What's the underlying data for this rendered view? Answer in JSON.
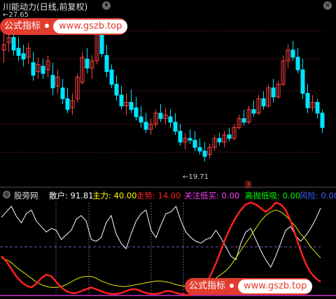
{
  "title": "川能动力(日线,前复权)",
  "upper": {
    "high_label": "27.65",
    "low_label": "19.71",
    "signal": "涨"
  },
  "badges": {
    "label": "公式指标",
    "site": "www.gszb.top"
  },
  "indicator": {
    "name": "股旁网",
    "items": [
      {
        "label": "散户",
        "value": "91.81",
        "color": "#ffffff"
      },
      {
        "label": "主力",
        "value": "40.00",
        "color": "#ffff00"
      },
      {
        "label": "走势",
        "value": "14.00",
        "color": "#ff2020"
      },
      {
        "label": "关注低买",
        "value": "0.00",
        "color": "#ff40ff"
      },
      {
        "label": "高抛低吸",
        "value": "0.00",
        "color": "#00ff00"
      },
      {
        "label": "风险",
        "value": "0.00",
        "color": "#4060ff"
      }
    ]
  },
  "colors": {
    "up": "#ff4040",
    "down": "#00e5ff",
    "grid": "#b03030",
    "ind_grid": "#7a4fb0"
  },
  "candles": [
    [
      25.9,
      26.8,
      25.2,
      26.2
    ],
    [
      26.3,
      27.2,
      25.8,
      26.6
    ],
    [
      26.6,
      27.65,
      25.6,
      25.9
    ],
    [
      26.0,
      26.6,
      25.3,
      25.6
    ],
    [
      25.7,
      26.2,
      25.0,
      25.4
    ],
    [
      25.5,
      26.3,
      25.1,
      26.0
    ],
    [
      25.2,
      25.8,
      24.2,
      24.5
    ],
    [
      24.7,
      25.5,
      24.3,
      25.1
    ],
    [
      25.0,
      25.4,
      24.3,
      24.6
    ],
    [
      24.8,
      25.6,
      24.4,
      25.3
    ],
    [
      24.5,
      25.2,
      23.4,
      23.8
    ],
    [
      23.9,
      24.8,
      23.5,
      24.4
    ],
    [
      23.8,
      24.3,
      22.9,
      23.2
    ],
    [
      23.2,
      23.8,
      22.4,
      22.6
    ],
    [
      22.7,
      23.5,
      22.3,
      23.1
    ],
    [
      23.2,
      24.6,
      23.0,
      24.4
    ],
    [
      24.1,
      25.8,
      24.0,
      25.5
    ],
    [
      25.4,
      26.0,
      24.6,
      24.9
    ],
    [
      24.9,
      25.6,
      24.3,
      25.3
    ],
    [
      25.3,
      27.1,
      25.1,
      26.9
    ],
    [
      26.8,
      27.4,
      25.5,
      25.7
    ],
    [
      25.6,
      26.2,
      24.4,
      24.7
    ],
    [
      24.8,
      25.1,
      23.8,
      24.0
    ],
    [
      24.0,
      24.5,
      23.1,
      23.4
    ],
    [
      23.4,
      23.9,
      22.6,
      22.8
    ],
    [
      22.8,
      23.5,
      22.3,
      23.0
    ],
    [
      23.0,
      23.7,
      22.4,
      22.6
    ],
    [
      22.7,
      23.3,
      22.0,
      22.2
    ],
    [
      22.2,
      22.8,
      21.6,
      21.9
    ],
    [
      21.9,
      22.4,
      21.3,
      21.5
    ],
    [
      21.5,
      22.1,
      21.2,
      21.8
    ],
    [
      21.8,
      22.6,
      21.6,
      22.4
    ],
    [
      22.4,
      22.9,
      21.9,
      22.1
    ],
    [
      22.1,
      22.7,
      21.8,
      22.3
    ],
    [
      22.2,
      22.6,
      21.6,
      21.9
    ],
    [
      21.9,
      22.4,
      21.2,
      21.4
    ],
    [
      21.4,
      21.8,
      20.6,
      20.8
    ],
    [
      20.8,
      21.3,
      20.4,
      21.0
    ],
    [
      21.0,
      21.5,
      20.7,
      20.9
    ],
    [
      20.9,
      21.4,
      20.3,
      20.5
    ],
    [
      20.5,
      21.0,
      20.1,
      20.3
    ],
    [
      20.3,
      20.8,
      19.71,
      20.0
    ],
    [
      20.1,
      20.7,
      19.9,
      20.5
    ],
    [
      20.5,
      21.2,
      20.3,
      21.0
    ],
    [
      21.0,
      21.3,
      20.6,
      20.8
    ],
    [
      20.8,
      21.4,
      20.5,
      21.2
    ],
    [
      21.2,
      21.6,
      20.8,
      21.0
    ],
    [
      21.0,
      21.8,
      20.9,
      21.6
    ],
    [
      21.6,
      22.3,
      21.5,
      22.1
    ],
    [
      22.1,
      22.6,
      21.7,
      21.9
    ],
    [
      21.9,
      22.8,
      21.8,
      22.6
    ],
    [
      22.6,
      23.1,
      22.2,
      22.4
    ],
    [
      22.4,
      23.4,
      22.3,
      23.2
    ],
    [
      23.2,
      23.6,
      22.6,
      22.8
    ],
    [
      22.8,
      24.0,
      22.7,
      23.8
    ],
    [
      23.8,
      24.3,
      23.0,
      23.3
    ],
    [
      23.3,
      24.2,
      23.2,
      24.0
    ],
    [
      24.0,
      25.6,
      23.9,
      25.3
    ],
    [
      25.3,
      26.2,
      24.9,
      25.9
    ],
    [
      25.9,
      26.4,
      25.3,
      25.5
    ],
    [
      25.5,
      26.0,
      24.6,
      24.8
    ],
    [
      24.8,
      25.4,
      23.2,
      23.5
    ],
    [
      23.5,
      24.0,
      22.4,
      22.7
    ],
    [
      22.7,
      23.4,
      22.5,
      23.0
    ],
    [
      23.0,
      23.2,
      22.1,
      22.4
    ],
    [
      22.4,
      22.6,
      21.3,
      21.6
    ]
  ],
  "series": {
    "retail": [
      84,
      90,
      96,
      85,
      78,
      88,
      92,
      80,
      74,
      68,
      72,
      70,
      60,
      65,
      70,
      82,
      86,
      80,
      60,
      58,
      62,
      78,
      86,
      66,
      56,
      50,
      66,
      80,
      88,
      92,
      70,
      62,
      76,
      88,
      90,
      96,
      80,
      68,
      62,
      58,
      56,
      60,
      62,
      70,
      62,
      52,
      42,
      38,
      56,
      68,
      72,
      60,
      48,
      38,
      30,
      42,
      56,
      70,
      74,
      64,
      58,
      64,
      72,
      82,
      94
    ],
    "main": [
      40,
      38,
      35,
      30,
      26,
      22,
      18,
      14,
      11,
      9,
      8,
      8,
      9,
      11,
      14,
      17,
      19,
      20,
      20,
      18,
      15,
      13,
      11,
      10,
      9,
      9,
      10,
      11,
      12,
      13,
      14,
      15,
      15,
      14,
      13,
      11,
      10,
      9,
      9,
      10,
      11,
      13,
      15,
      18,
      22,
      26,
      32,
      40,
      48,
      56,
      64,
      72,
      80,
      86,
      90,
      92,
      90,
      86,
      80,
      74,
      66,
      60,
      52,
      46,
      40
    ],
    "trend": [
      42,
      36,
      28,
      20,
      14,
      10,
      8,
      12,
      18,
      22,
      20,
      14,
      8,
      4,
      2,
      2,
      4,
      6,
      8,
      6,
      4,
      2,
      1,
      1,
      2,
      4,
      6,
      6,
      4,
      2,
      1,
      1,
      2,
      4,
      4,
      2,
      1,
      0,
      0,
      2,
      6,
      12,
      22,
      34,
      48,
      62,
      74,
      84,
      92,
      98,
      100,
      98,
      94,
      90,
      94,
      100,
      98,
      92,
      80,
      64,
      48,
      34,
      24,
      18,
      14
    ]
  }
}
